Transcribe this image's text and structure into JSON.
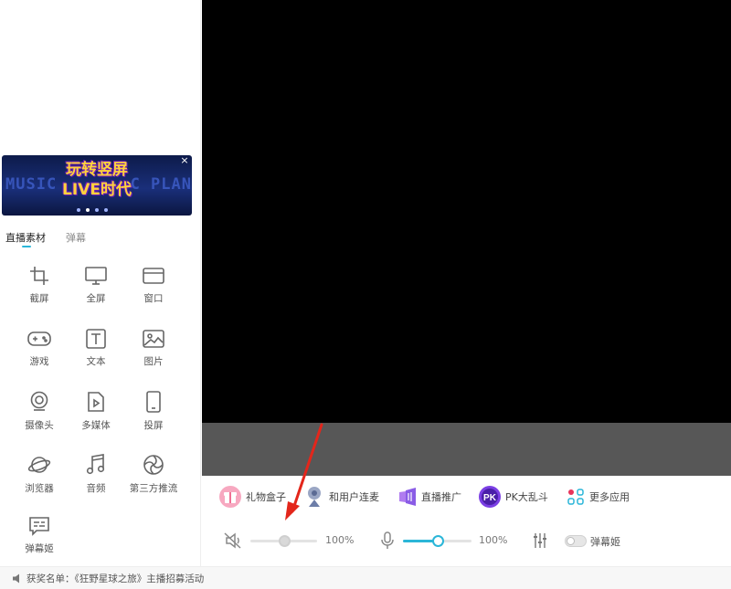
{
  "banner": {
    "bg_left": "MUSIC",
    "bg_right": "C PLAN",
    "title_line1": "玩转竖屏",
    "title_line2": "LIVE时代",
    "close": "×"
  },
  "tabs": [
    {
      "label": "直播素材",
      "active": true
    },
    {
      "label": "弹幕",
      "active": false
    }
  ],
  "tools": [
    {
      "label": "截屏",
      "icon": "crop-icon"
    },
    {
      "label": "全屏",
      "icon": "monitor-icon"
    },
    {
      "label": "窗口",
      "icon": "window-icon"
    },
    {
      "label": "游戏",
      "icon": "gamepad-icon"
    },
    {
      "label": "文本",
      "icon": "text-icon"
    },
    {
      "label": "图片",
      "icon": "image-icon"
    },
    {
      "label": "摄像头",
      "icon": "webcam-icon"
    },
    {
      "label": "多媒体",
      "icon": "media-file-icon"
    },
    {
      "label": "投屏",
      "icon": "phone-icon"
    },
    {
      "label": "浏览器",
      "icon": "planet-icon"
    },
    {
      "label": "音频",
      "icon": "music-note-icon"
    },
    {
      "label": "第三方推流",
      "icon": "aperture-icon"
    },
    {
      "label": "弹幕姬",
      "icon": "chat-box-icon"
    }
  ],
  "apps": [
    {
      "label": "礼物盒子",
      "icon": "gift-box-icon",
      "color": "#f06f94"
    },
    {
      "label": "和用户连麦",
      "icon": "mic-link-icon",
      "color": "#6d7ea8"
    },
    {
      "label": "直播推广",
      "icon": "promote-icon",
      "color": "#8a5ce6"
    },
    {
      "label": "PK大乱斗",
      "icon": "pk-icon",
      "color": "#7b3fe4",
      "badge": "PK"
    },
    {
      "label": "更多应用",
      "icon": "more-apps-icon",
      "color": "#2bb6d8"
    }
  ],
  "controls": {
    "speaker_volume": "100%",
    "speaker_level": 0.5,
    "speaker_muted": true,
    "mic_volume": "100%",
    "mic_level": 0.5,
    "danmaku_toggle_label": "弹幕姬",
    "danmaku_toggle_on": false
  },
  "colors": {
    "accent": "#2bb6d8",
    "preview_bg": "#000000",
    "preview_strip": "#575757",
    "annotation": "#e3261b"
  },
  "footer": {
    "text": "获奖名单：《狂野星球之旅》主播招募活动"
  }
}
